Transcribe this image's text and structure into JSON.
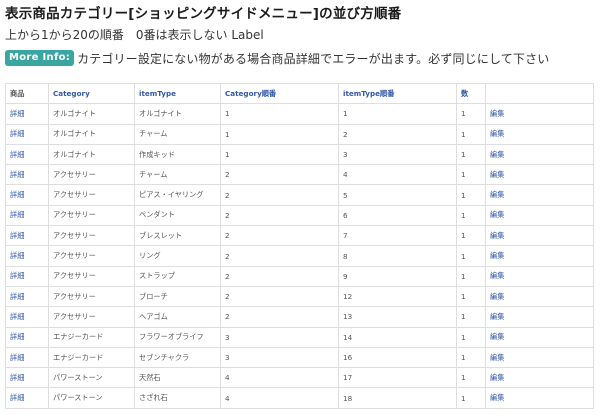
{
  "header": {
    "title": "表示商品カテゴリー[ショッピングサイドメニュー]の並び方順番",
    "subtitle": "上から1から20の順番　0番は表示しない Label",
    "info_badge": "More Info:",
    "info_text": "カテゴリー設定にない物がある場合商品詳細でエラーが出ます。必ず同じにして下さい"
  },
  "table": {
    "columns": [
      "商品",
      "Category",
      "itemType",
      "Category順番",
      "itemType順番",
      "数",
      ""
    ],
    "rows": [
      {
        "link": "詳細",
        "category": "オルゴナイト",
        "itemType": "オルゴナイト",
        "cat_order": "1",
        "type_order": "1",
        "count": "1",
        "edit": "編集"
      },
      {
        "link": "詳細",
        "category": "オルゴナイト",
        "itemType": "チャーム",
        "cat_order": "1",
        "type_order": "2",
        "count": "1",
        "edit": "編集"
      },
      {
        "link": "詳細",
        "category": "オルゴナイト",
        "itemType": "作成キッド",
        "cat_order": "1",
        "type_order": "3",
        "count": "1",
        "edit": "編集"
      },
      {
        "link": "詳細",
        "category": "アクセサリー",
        "itemType": "チャーム",
        "cat_order": "2",
        "type_order": "4",
        "count": "1",
        "edit": "編集"
      },
      {
        "link": "詳細",
        "category": "アクセサリー",
        "itemType": "ピアス・イヤリング",
        "cat_order": "2",
        "type_order": "5",
        "count": "1",
        "edit": "編集"
      },
      {
        "link": "詳細",
        "category": "アクセサリー",
        "itemType": "ペンダント",
        "cat_order": "2",
        "type_order": "6",
        "count": "1",
        "edit": "編集"
      },
      {
        "link": "詳細",
        "category": "アクセサリー",
        "itemType": "ブレスレット",
        "cat_order": "2",
        "type_order": "7",
        "count": "1",
        "edit": "編集"
      },
      {
        "link": "詳細",
        "category": "アクセサリー",
        "itemType": "リング",
        "cat_order": "2",
        "type_order": "8",
        "count": "1",
        "edit": "編集"
      },
      {
        "link": "詳細",
        "category": "アクセサリー",
        "itemType": "ストラップ",
        "cat_order": "2",
        "type_order": "9",
        "count": "1",
        "edit": "編集"
      },
      {
        "link": "詳細",
        "category": "アクセサリー",
        "itemType": "ブローチ",
        "cat_order": "2",
        "type_order": "12",
        "count": "1",
        "edit": "編集"
      },
      {
        "link": "詳細",
        "category": "アクセサリー",
        "itemType": "ヘアゴム",
        "cat_order": "2",
        "type_order": "13",
        "count": "1",
        "edit": "編集"
      },
      {
        "link": "詳細",
        "category": "エナジーカード",
        "itemType": "フラワーオブライフ",
        "cat_order": "3",
        "type_order": "14",
        "count": "1",
        "edit": "編集"
      },
      {
        "link": "詳細",
        "category": "エナジーカード",
        "itemType": "セブンチャクラ",
        "cat_order": "3",
        "type_order": "16",
        "count": "1",
        "edit": "編集"
      },
      {
        "link": "詳細",
        "category": "パワーストーン",
        "itemType": "天然石",
        "cat_order": "4",
        "type_order": "17",
        "count": "1",
        "edit": "編集"
      },
      {
        "link": "詳細",
        "category": "パワーストーン",
        "itemType": "さざれ石",
        "cat_order": "4",
        "type_order": "18",
        "count": "1",
        "edit": "編集"
      }
    ]
  }
}
